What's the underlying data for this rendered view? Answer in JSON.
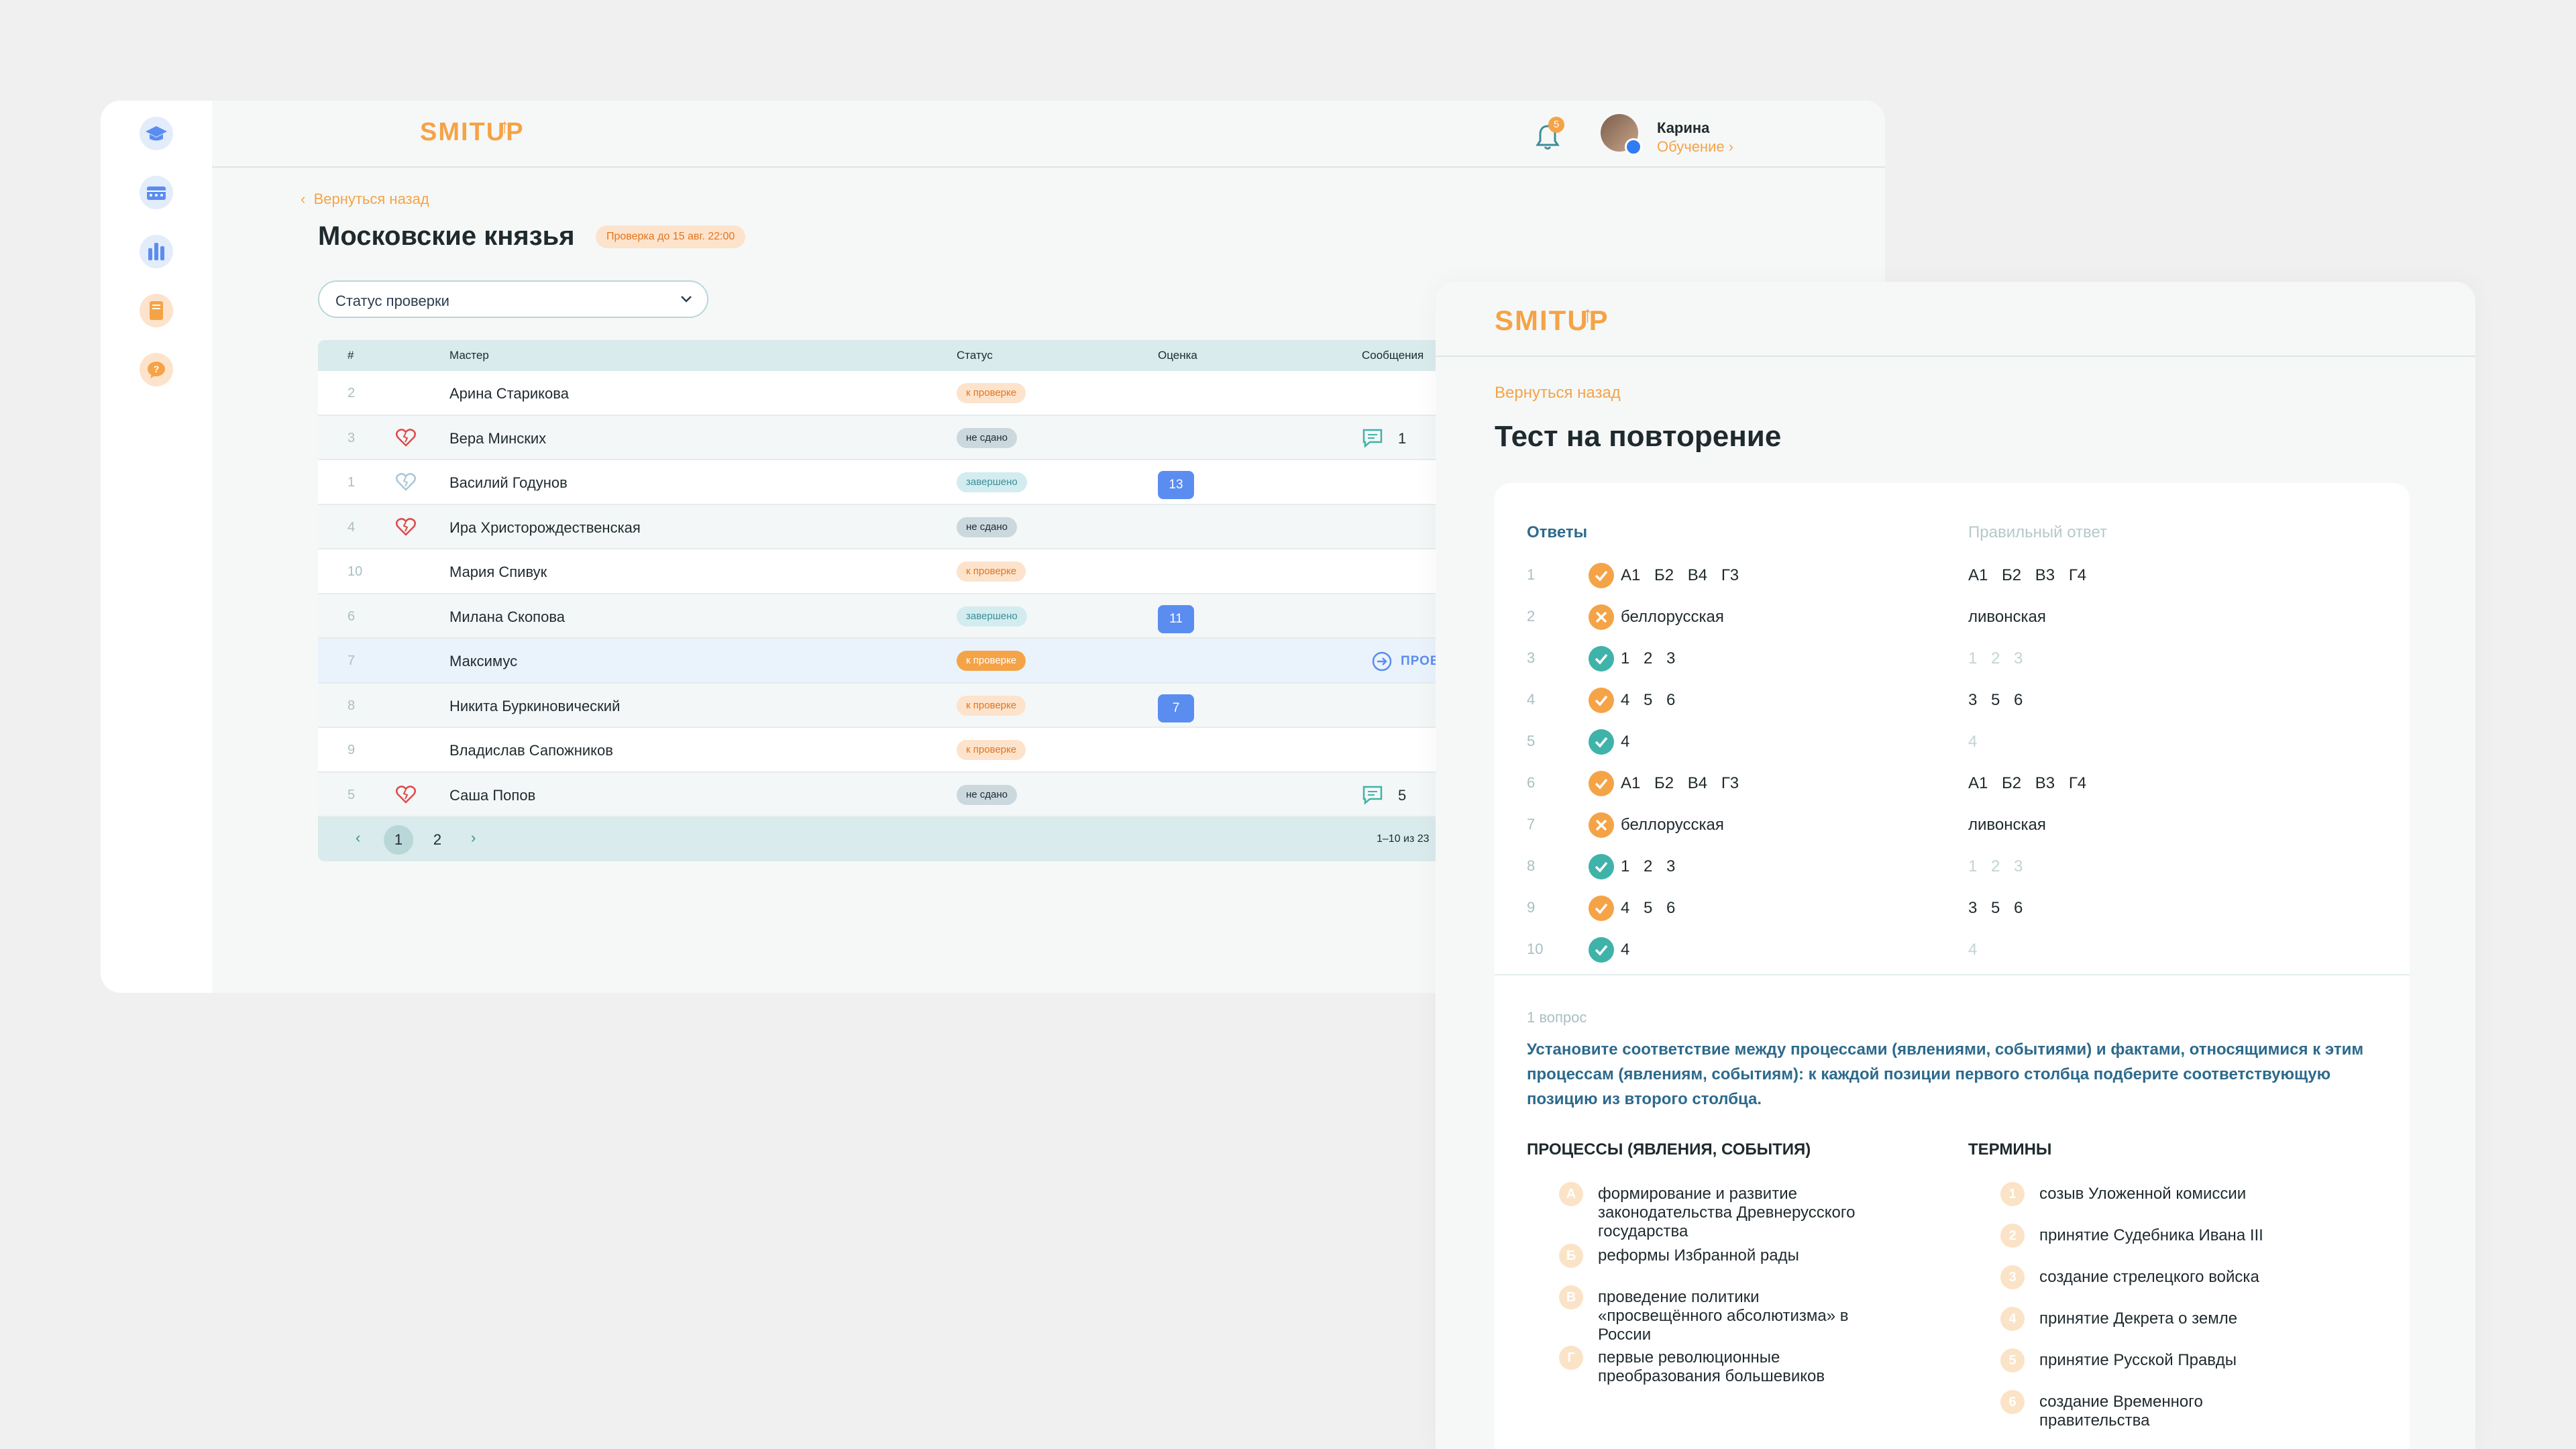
{
  "app": {
    "logo_text": "SMIT",
    "logo_up": "UP",
    "notifications_count": "5",
    "user_name": "Карина",
    "user_sub": "Обучение",
    "accent_color": "#f5a347",
    "primary_blue": "#5b8df0"
  },
  "sidebar": {
    "items": [
      {
        "icon": "graduation-cap-icon"
      },
      {
        "icon": "schedule-icon"
      },
      {
        "icon": "stats-icon"
      },
      {
        "icon": "book-icon"
      },
      {
        "icon": "help-icon"
      }
    ]
  },
  "list_page": {
    "back_label": "Вернуться назад",
    "title": "Московские князья",
    "deadline": "Проверка до 15 авг. 22:00",
    "filter_placeholder": "Статус проверки",
    "columns": {
      "num": "#",
      "master": "Мастер",
      "status": "Статус",
      "score": "Оценка",
      "messages": "Сообщения"
    },
    "rows": [
      {
        "num": "2",
        "name": "Арина Старикова",
        "status": "к проверке",
        "status_type": "review",
        "heart": "",
        "score": "",
        "messages": ""
      },
      {
        "num": "3",
        "name": "Вера Минских",
        "status": "не сдано",
        "status_type": "fail",
        "heart": "broken",
        "score": "",
        "messages": "1"
      },
      {
        "num": "1",
        "name": "Василий Годунов",
        "status": "завершено",
        "status_type": "done",
        "heart": "light",
        "score": "13",
        "messages": ""
      },
      {
        "num": "4",
        "name": "Ира Христорождественская",
        "status": "не сдано",
        "status_type": "fail",
        "heart": "broken",
        "score": "",
        "messages": ""
      },
      {
        "num": "10",
        "name": "Мария Спивук",
        "status": "к проверке",
        "status_type": "review",
        "heart": "",
        "score": "",
        "messages": ""
      },
      {
        "num": "6",
        "name": "Милана Скопова",
        "status": "завершено",
        "status_type": "done",
        "heart": "",
        "score": "11",
        "messages": ""
      },
      {
        "num": "7",
        "name": "Максимус",
        "status": "к проверке",
        "status_type": "review-active",
        "heart": "",
        "score": "",
        "messages": "",
        "action": "ПРОВЕРИТЬ"
      },
      {
        "num": "8",
        "name": "Никита Буркиновический",
        "status": "к проверке",
        "status_type": "review",
        "heart": "",
        "score": "7",
        "messages": ""
      },
      {
        "num": "9",
        "name": "Владислав Сапожников",
        "status": "к проверке",
        "status_type": "review",
        "heart": "",
        "score": "",
        "messages": ""
      },
      {
        "num": "5",
        "name": "Саша Попов",
        "status": "не сдано",
        "status_type": "fail",
        "heart": "broken",
        "score": "",
        "messages": "5"
      }
    ],
    "pagination": {
      "prev": "‹",
      "pages": [
        "1",
        "2"
      ],
      "next": "›",
      "current": 1,
      "range": "1–10 из 23"
    }
  },
  "test_page": {
    "back_label": "Вернуться назад",
    "title": "Тест на повторение",
    "answers_header": "Ответы",
    "correct_header": "Правильный ответ",
    "answers": [
      {
        "num": "1",
        "answer": "А1 Б2 В4 Г3",
        "result": "partial",
        "correct": "А1 Б2 В3 Г4",
        "correct_style": "dark"
      },
      {
        "num": "2",
        "answer": "беллорусская",
        "result": "wrong",
        "correct": "ливонская",
        "correct_style": "dark"
      },
      {
        "num": "3",
        "answer": "1 2 3",
        "result": "right",
        "correct": "1 2 3",
        "correct_style": "light"
      },
      {
        "num": "4",
        "answer": "4 5 6",
        "result": "partial",
        "correct": "3 5 6",
        "correct_style": "dark"
      },
      {
        "num": "5",
        "answer": "4",
        "result": "right",
        "correct": "4",
        "correct_style": "light"
      },
      {
        "num": "6",
        "answer": "А1 Б2 В4 Г3",
        "result": "partial",
        "correct": "А1 Б2 В3 Г4",
        "correct_style": "dark"
      },
      {
        "num": "7",
        "answer": "беллорусская",
        "result": "wrong",
        "correct": "ливонская",
        "correct_style": "dark"
      },
      {
        "num": "8",
        "answer": "1 2 3",
        "result": "right",
        "correct": "1 2 3",
        "correct_style": "light"
      },
      {
        "num": "9",
        "answer": "4 5 6",
        "result": "partial",
        "correct": "3 5 6",
        "correct_style": "dark"
      },
      {
        "num": "10",
        "answer": "4",
        "result": "right",
        "correct": "4",
        "correct_style": "light"
      }
    ],
    "question_label": "1 вопрос",
    "question_text": "Установите соответствие между процессами (явлениями, событиями) и фактами, относящимися к этим процессам (явлениям, событиям): к каждой позиции первого столбца подберите соответствующую позицию из второго столбца.",
    "left_title": "ПРОЦЕССЫ (ЯВЛЕНИЯ, СОБЫТИЯ)",
    "right_title": "ТЕРМИНЫ",
    "left_items": [
      {
        "mark": "А",
        "text": "формирование и развитие законодательства Древнерусского государства"
      },
      {
        "mark": "Б",
        "text": "реформы Избранной рады"
      },
      {
        "mark": "В",
        "text": "проведение политики «просвещённого абсолютизма» в России"
      },
      {
        "mark": "Г",
        "text": "первые революционные преобразования большевиков"
      }
    ],
    "right_items": [
      {
        "mark": "1",
        "text": "созыв Уложенной комиссии"
      },
      {
        "mark": "2",
        "text": "принятие Судебника Ивана III"
      },
      {
        "mark": "3",
        "text": "создание стрелецкого войска"
      },
      {
        "mark": "4",
        "text": "принятие Декрета о земле"
      },
      {
        "mark": "5",
        "text": "принятие Русской Правды"
      },
      {
        "mark": "6",
        "text": "создание Временного правительства"
      }
    ]
  }
}
